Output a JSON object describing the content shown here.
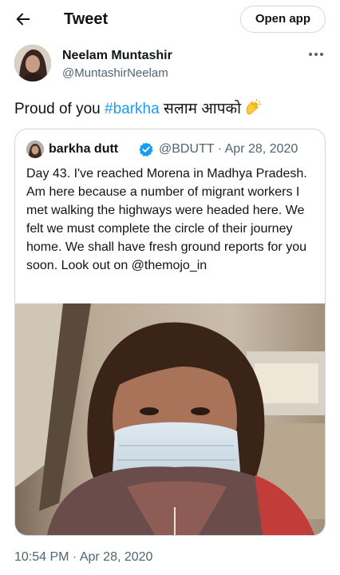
{
  "header": {
    "title": "Tweet",
    "open_app_label": "Open app"
  },
  "tweet": {
    "author_name": "Neelam Muntashir",
    "author_handle": "@MuntashirNeelam",
    "text_before": "Proud of you ",
    "hashtag": "#barkha",
    "text_after": " सलाम आपको",
    "emoji": "clapping-hands",
    "timestamp": "10:54 PM · Apr 28, 2020"
  },
  "quoted_tweet": {
    "author_name": "barkha dutt",
    "author_handle": "@BDUTT · Apr 28, 2020",
    "text": "Day 43. I've reached Morena in Madhya Pradesh. Am here because a number of migrant workers I met walking the highways were headed here. We felt we must complete the circle of their journey home. We shall have fresh ground reports for you soon. Look out on @themojo_in"
  },
  "colors": {
    "link": "#1d9bf0",
    "secondary_text": "#536471",
    "border": "#cfd9de"
  },
  "icons": [
    "arrow-left-icon",
    "more-icon",
    "clap-emoji-icon",
    "verified-badge-icon"
  ]
}
